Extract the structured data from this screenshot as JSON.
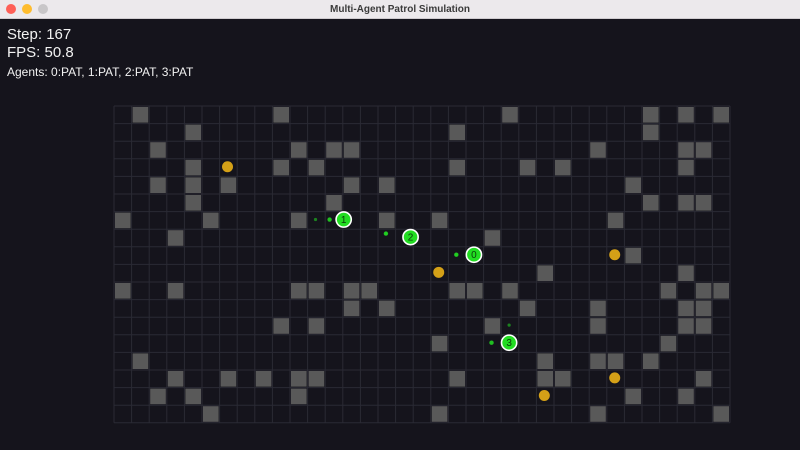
{
  "window": {
    "title": "Multi-Agent Patrol Simulation"
  },
  "hud": {
    "step": "Step: 167",
    "fps": "FPS: 50.8",
    "agents": "Agents: 0:PAT, 1:PAT, 2:PAT, 3:PAT"
  },
  "colors": {
    "background": "#15141c",
    "grid_line": "#2a2a34",
    "obstacle": "#595959",
    "goal": "#d4a017",
    "agent": "#22dd22",
    "agent_outline": "#ffffff"
  },
  "grid": {
    "cols": 35,
    "rows": 18,
    "obstacles": [
      [
        1,
        0
      ],
      [
        9,
        0
      ],
      [
        22,
        0
      ],
      [
        30,
        0
      ],
      [
        32,
        0
      ],
      [
        34,
        0
      ],
      [
        4,
        1
      ],
      [
        19,
        1
      ],
      [
        30,
        1
      ],
      [
        2,
        2
      ],
      [
        10,
        2
      ],
      [
        12,
        2
      ],
      [
        13,
        2
      ],
      [
        27,
        2
      ],
      [
        32,
        2
      ],
      [
        33,
        2
      ],
      [
        4,
        3
      ],
      [
        9,
        3
      ],
      [
        11,
        3
      ],
      [
        19,
        3
      ],
      [
        23,
        3
      ],
      [
        25,
        3
      ],
      [
        32,
        3
      ],
      [
        2,
        4
      ],
      [
        4,
        4
      ],
      [
        6,
        4
      ],
      [
        13,
        4
      ],
      [
        15,
        4
      ],
      [
        29,
        4
      ],
      [
        4,
        5
      ],
      [
        12,
        5
      ],
      [
        30,
        5
      ],
      [
        32,
        5
      ],
      [
        33,
        5
      ],
      [
        0,
        6
      ],
      [
        5,
        6
      ],
      [
        10,
        6
      ],
      [
        15,
        6
      ],
      [
        18,
        6
      ],
      [
        28,
        6
      ],
      [
        3,
        7
      ],
      [
        21,
        7
      ],
      [
        29,
        8
      ],
      [
        24,
        9
      ],
      [
        32,
        9
      ],
      [
        0,
        10
      ],
      [
        3,
        10
      ],
      [
        10,
        10
      ],
      [
        11,
        10
      ],
      [
        13,
        10
      ],
      [
        14,
        10
      ],
      [
        19,
        10
      ],
      [
        20,
        10
      ],
      [
        22,
        10
      ],
      [
        31,
        10
      ],
      [
        33,
        10
      ],
      [
        34,
        10
      ],
      [
        13,
        11
      ],
      [
        15,
        11
      ],
      [
        23,
        11
      ],
      [
        27,
        11
      ],
      [
        32,
        11
      ],
      [
        33,
        11
      ],
      [
        9,
        12
      ],
      [
        11,
        12
      ],
      [
        21,
        12
      ],
      [
        27,
        12
      ],
      [
        32,
        12
      ],
      [
        33,
        12
      ],
      [
        18,
        13
      ],
      [
        31,
        13
      ],
      [
        1,
        14
      ],
      [
        24,
        14
      ],
      [
        27,
        14
      ],
      [
        28,
        14
      ],
      [
        30,
        14
      ],
      [
        3,
        15
      ],
      [
        6,
        15
      ],
      [
        8,
        15
      ],
      [
        10,
        15
      ],
      [
        11,
        15
      ],
      [
        19,
        15
      ],
      [
        24,
        15
      ],
      [
        25,
        15
      ],
      [
        33,
        15
      ],
      [
        2,
        16
      ],
      [
        4,
        16
      ],
      [
        10,
        16
      ],
      [
        29,
        16
      ],
      [
        32,
        16
      ],
      [
        5,
        17
      ],
      [
        18,
        17
      ],
      [
        27,
        17
      ],
      [
        34,
        17
      ]
    ]
  },
  "goals": [
    [
      6.45,
      3.45
    ],
    [
      18.45,
      9.45
    ],
    [
      28.45,
      8.45
    ],
    [
      28.45,
      15.45
    ],
    [
      24.45,
      16.45
    ]
  ],
  "agents": [
    {
      "id": "0",
      "cell": [
        20.45,
        8.45
      ],
      "trail": [
        [
          19.45,
          8.45
        ],
        [
          19.45,
          8.45
        ]
      ]
    },
    {
      "id": "1",
      "cell": [
        13.05,
        6.45
      ],
      "trail": [
        [
          12.25,
          6.45
        ],
        [
          11.45,
          6.45
        ]
      ]
    },
    {
      "id": "2",
      "cell": [
        16.85,
        7.45
      ],
      "trail": [
        [
          15.45,
          7.25
        ],
        [
          15.45,
          7.25
        ]
      ]
    },
    {
      "id": "3",
      "cell": [
        22.45,
        13.45
      ],
      "trail": [
        [
          21.45,
          13.45
        ],
        [
          22.45,
          12.45
        ]
      ]
    }
  ]
}
